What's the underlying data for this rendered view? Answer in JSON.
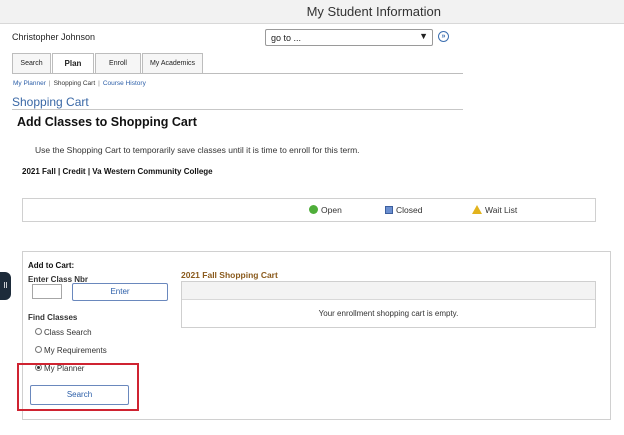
{
  "header": {
    "app_title": "My Student Information"
  },
  "user": {
    "name": "Christopher Johnson"
  },
  "nav": {
    "goto_value": "go to ...",
    "goto_button": "»"
  },
  "tabs": [
    {
      "label": "Search"
    },
    {
      "label": "Plan",
      "active": true
    },
    {
      "label": "Enroll"
    },
    {
      "label": "My Academics"
    }
  ],
  "breadcrumb": {
    "items": [
      "My Planner",
      "Shopping Cart",
      "Course History"
    ],
    "separator": "|"
  },
  "page": {
    "section_title": "Shopping Cart",
    "title": "Add Classes to Shopping Cart",
    "instructions": "Use the Shopping Cart to temporarily save classes until it is time to enroll for this term.",
    "term": "2021 Fall | Credit | Va Western Community College"
  },
  "legend": {
    "open": "Open",
    "closed": "Closed",
    "wait_list": "Wait List",
    "colors": {
      "open": "#4fae3a",
      "closed": "#6b8fd0",
      "wait_list": "#e2b31d"
    }
  },
  "add_to_cart": {
    "title": "Add to Cart:",
    "class_nbr_label": "Enter Class Nbr",
    "class_nbr_value": "",
    "enter_button": "Enter",
    "find_label": "Find Classes",
    "options": [
      {
        "label": "Class Search",
        "selected": false
      },
      {
        "label": "My Requirements",
        "selected": false
      },
      {
        "label": "My Planner",
        "selected": true
      }
    ],
    "search_button": "Search"
  },
  "cart": {
    "title": "2021 Fall Shopping Cart",
    "empty_message": "Your enrollment shopping cart is empty."
  },
  "side_handle": {
    "label": "II"
  },
  "colors": {
    "highlight": "#cf2331",
    "link": "#2b5ea8",
    "section_title": "#3a68a6",
    "cart_title": "#8a5a1c"
  }
}
